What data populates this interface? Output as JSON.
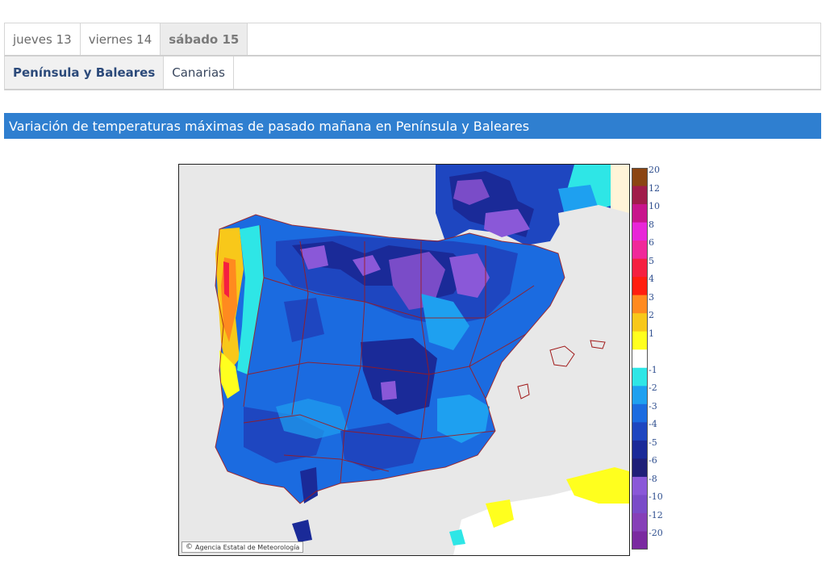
{
  "day_tabs": [
    {
      "label": "jueves 13",
      "active": false
    },
    {
      "label": "viernes 14",
      "active": false
    },
    {
      "label": "sábado 15",
      "active": true
    }
  ],
  "region_tabs": [
    {
      "label": "Península y Baleares",
      "active": true
    },
    {
      "label": "Canarias",
      "active": false
    }
  ],
  "map_title": "Variación de temperaturas máximas de pasado mañana en Península y Baleares",
  "map": {
    "credit": "Agencia Estatal de Meteorología",
    "credit_icon": "copyright-icon",
    "legend": [
      {
        "label": "20",
        "color": "#8b4513"
      },
      {
        "label": "12",
        "color": "#a01c4a"
      },
      {
        "label": "10",
        "color": "#c8148c"
      },
      {
        "label": "8",
        "color": "#e826d8"
      },
      {
        "label": "6",
        "color": "#f0289a"
      },
      {
        "label": "5",
        "color": "#f52040"
      },
      {
        "label": "4",
        "color": "#ff1e0f"
      },
      {
        "label": "3",
        "color": "#ff8a1f"
      },
      {
        "label": "2",
        "color": "#f8c81a"
      },
      {
        "label": "1",
        "color": "#ffff1e"
      },
      {
        "label": "",
        "color": "#ffffff"
      },
      {
        "label": "-1",
        "color": "#2ee6e6"
      },
      {
        "label": "-2",
        "color": "#1ea0f0"
      },
      {
        "label": "-3",
        "color": "#1b6be0"
      },
      {
        "label": "-4",
        "color": "#1e46c0"
      },
      {
        "label": "-5",
        "color": "#1a2a98"
      },
      {
        "label": "-6",
        "color": "#1e1f78"
      },
      {
        "label": "-8",
        "color": "#8a58d8"
      },
      {
        "label": "-10",
        "color": "#7a4cc8"
      },
      {
        "label": "-12",
        "color": "#8640b8"
      },
      {
        "label": "-20",
        "color": "#7a2aa0"
      }
    ]
  }
}
